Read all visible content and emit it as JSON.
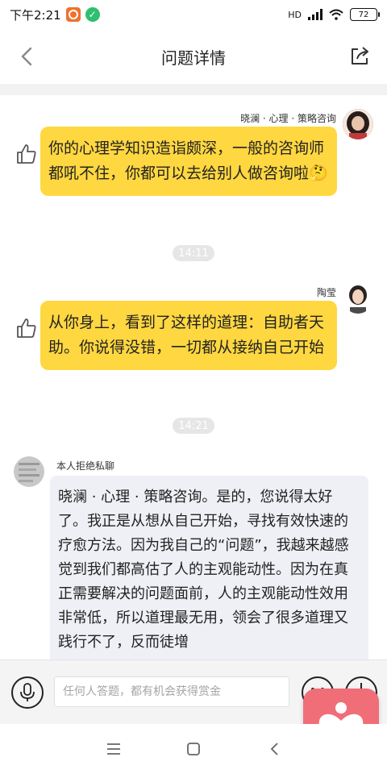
{
  "status_bar": {
    "time": "下午2:21",
    "network": "HD",
    "battery": "72"
  },
  "header": {
    "title": "问题详情"
  },
  "messages": [
    {
      "author": "晓澜 · 心理 · 策略咨询",
      "text": "你的心理学知识造诣颇深，一般的咨询师都吼不住，你都可以去给别人做咨询啦🤔"
    },
    {
      "time": "14:11"
    },
    {
      "author": "陶莹",
      "text": "从你身上，看到了这样的道理：自助者天助。你说得没错，一切都从接纳自己开始"
    },
    {
      "time": "14:21"
    },
    {
      "author": "本人拒绝私聊",
      "text": "晓澜 · 心理 · 策略咨询。是的，您说得太好了。我正是从想从自己开始，寻找有效快速的疗愈方法。因为我自己的“问题”，我越来越感觉到我们都高估了人的主观能动性。因为在真正需要解决的问题面前，人的主观能动性效用非常低，所以道理最无用，领会了很多道理又践行不了，反而徒增"
    }
  ],
  "input_bar": {
    "placeholder": "任何人答题，都有机会获得赏金"
  },
  "colors": {
    "bubble_yellow": "#ffd740",
    "bubble_grey": "#eef0f5",
    "float_button": "#f06e78"
  },
  "icons": {
    "back": "chevron-left-icon",
    "share": "share-icon",
    "like": "thumbs-up-icon",
    "mic": "microphone-icon",
    "emoji": "smiley-icon",
    "plus": "plus-icon",
    "heart": "heart-person-icon"
  }
}
